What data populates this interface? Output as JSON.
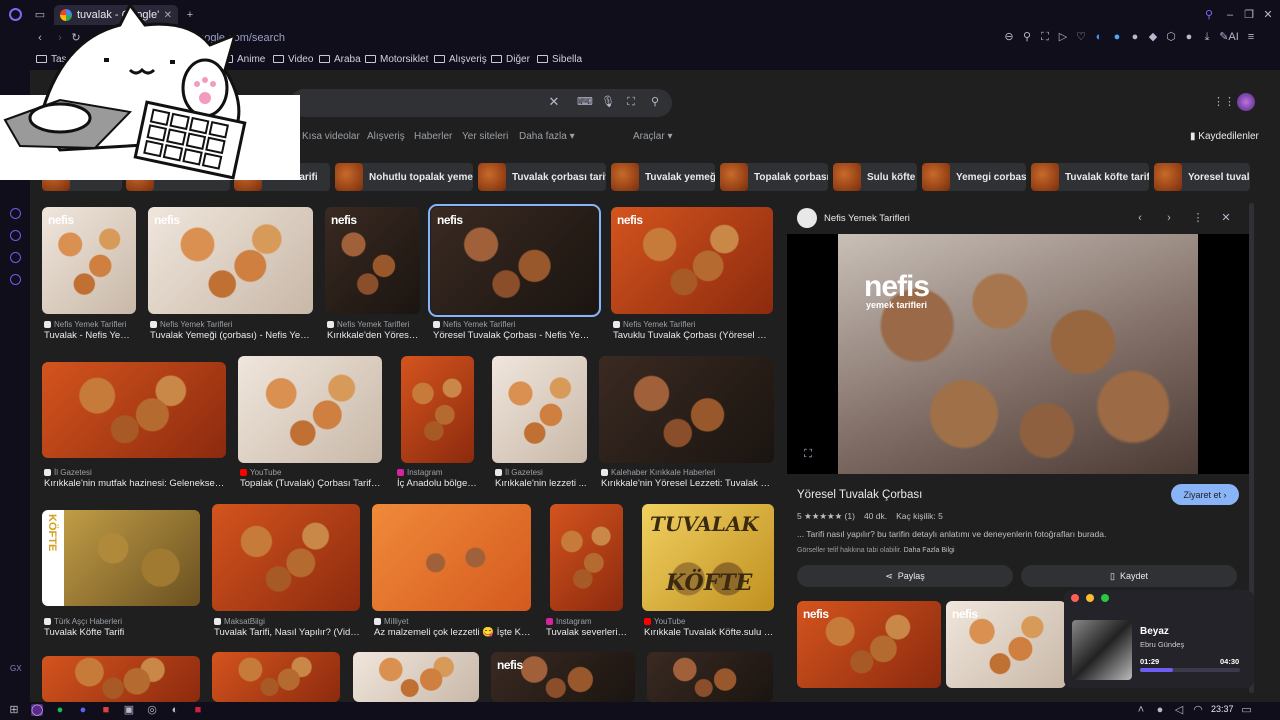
{
  "tab": {
    "title": "tuvalak - Google'da Ara"
  },
  "address": {
    "url": "google.com/search"
  },
  "bookmarks": [
    "Tasarım",
    "Anime",
    "Video",
    "Araba",
    "Motorsiklet",
    "Alışveriş",
    "Diğer",
    "Sibella"
  ],
  "search": {
    "filters": [
      "Kısa videolar",
      "Alışveriş",
      "Haberler",
      "Yer siteleri",
      "Daha fazla"
    ],
    "tools": "Araçlar",
    "saved": "Kaydedilenler"
  },
  "chips": [
    "tarifi",
    "Nohutlu topalak yemeği",
    "Tuvalak çorbası tarifi",
    "Tuvalak yemeği",
    "Topalak çorbası",
    "Sulu köfte",
    "Yemegi corbasi",
    "Tuvalak köfte tarifi",
    "Yoresel tuvalak"
  ],
  "row1": [
    {
      "source": "Nefis Yemek Tarifleri",
      "caption": "Tuvalak - Nefis Yem..."
    },
    {
      "source": "Nefis Yemek Tarifleri",
      "caption": "Tuvalak Yemeği (çorbası) - Nefis Yeme..."
    },
    {
      "source": "Nefis Yemek Tarifleri",
      "caption": "Kırıkkale'den Yörese..."
    },
    {
      "source": "Nefis Yemek Tarifleri",
      "caption": "Yöresel Tuvalak Çorbası - Nefis Yemek..."
    },
    {
      "source": "Nefis Yemek Tarifleri",
      "caption": "Tavuklu Tuvalak Çorbası (Yöresel Usta..."
    }
  ],
  "row2": [
    {
      "source": "İl Gazetesi",
      "caption": "Kırıkkale'nin mutfak hazinesi: Geleneksel tu..."
    },
    {
      "source": "YouTube",
      "caption": "Topalak (Tuvalak) Çorbası Tarifi - ..."
    },
    {
      "source": "Instagram",
      "caption": "İç Anadolu bölgesi..."
    },
    {
      "source": "İl Gazetesi",
      "caption": "Kırıkkale'nin lezzeti ..."
    },
    {
      "source": "Kalehaber Kırıkkale Haberleri",
      "caption": "Kırıkkale'nin Yöresel Lezzeti: Tuvalak Köft..."
    }
  ],
  "row3": [
    {
      "source": "Türk Aşçı Haberleri",
      "caption": "Tuvalak Köfte Tarifi"
    },
    {
      "source": "MaksatBilgi",
      "caption": "Tuvalak Tarifi, Nasıl Yapılır? (Video..."
    },
    {
      "source": "Milliyet",
      "caption": "Az malzemeli çok lezzetli 😋 İşte Kırı..."
    },
    {
      "source": "Instagram",
      "caption": "Tuvalak severleri g..."
    },
    {
      "source": "YouTube",
      "caption": "Kırıkkale Tuvalak Köfte.sulu K..."
    }
  ],
  "thumb_text": {
    "nefis": "nefis",
    "tuvalak": "TUVALAK",
    "kofte": "KÖFTE",
    "kofte_v": "KÖFTE"
  },
  "preview": {
    "source": "Nefis Yemek Tarifleri",
    "watermark": "nefis",
    "watermark_sub": "yemek tarifleri",
    "title": "Yöresel Tuvalak Çorbası",
    "visit": "Ziyaret et",
    "rating": "5 ★★★★★ (1)",
    "time": "40 dk.",
    "servings": "Kaç kişilik: 5",
    "description": "... Tarifi nasıl yapılır? bu tarifin detaylı anlatımı ve deneyenlerin fotoğrafları burada.",
    "copyright": "Görseller telif hakkına tabi olabilir.",
    "more_info": "Daha Fazla Bilgi",
    "share": "Paylaş",
    "save": "Kaydet"
  },
  "music": {
    "title": "Beyaz",
    "artist": "Ebru Gündeş",
    "elapsed": "01:29",
    "total": "04:30",
    "progress": 0.33
  },
  "taskbar": {
    "time": "23:37"
  },
  "colors": {
    "accent": "#8ab4f8",
    "brand": "#6d5df0"
  }
}
